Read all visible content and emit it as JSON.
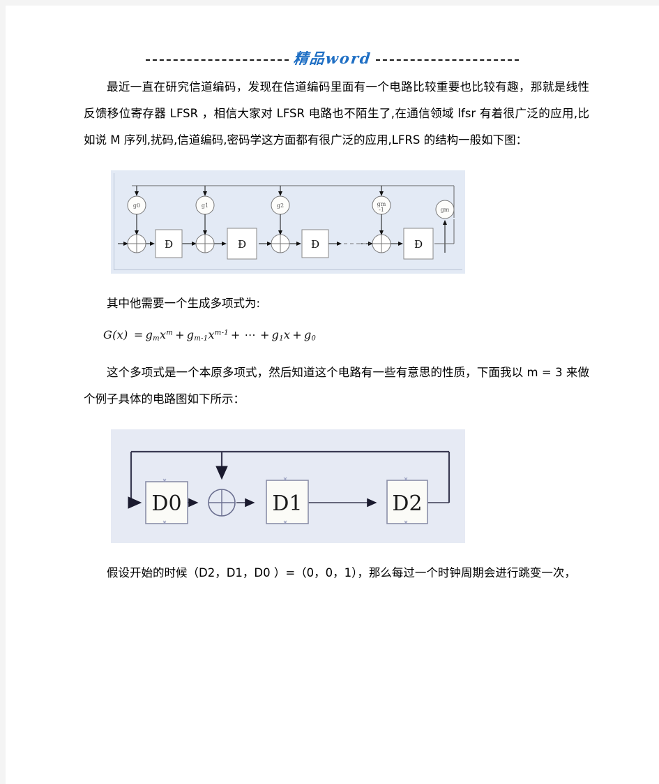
{
  "document": {
    "header": {
      "watermark": "精品word",
      "rule_style": "dashed"
    },
    "paragraphs": {
      "p1": "最近一直在研究信道编码，发现在信道编码里面有一个电路比较重要也比较有趣，那就是线性反馈移位寄存器 LFSR  ，相信大家对 LFSR  电路也不陌生了,在通信领域 lfsr 有着很广泛的应用,比如说 M 序列,扰码,信道编码,密码学这方面都有很广泛的应用,LFRS 的结构一般如下图：",
      "p2": "其中他需要一个生成多项式为:",
      "p3": "这个多项式是一个本原多项式，然后知道这个电路有一些有意思的性质，下面我以 m  = 3 来做个例子具体的电路图如下所示：",
      "p4": "假设开始的时候（D2，D1，D0  ）=（0，0，1），那么每过一个时钟周期会进行跳变一次，"
    },
    "formula": {
      "lhs": "G(x)",
      "equals": "=",
      "terms": [
        {
          "coef": "g",
          "coef_sub": "m",
          "var": "x",
          "var_sup": "m"
        },
        {
          "coef": "g",
          "coef_sub": "m-1",
          "var": "x",
          "var_sup": "m-1"
        },
        {
          "coef": "",
          "coef_sub": "",
          "var": "⋯",
          "var_sup": ""
        },
        {
          "coef": "g",
          "coef_sub": "1",
          "var": "x",
          "var_sup": ""
        },
        {
          "coef": "g",
          "coef_sub": "0",
          "var": "",
          "var_sup": ""
        }
      ],
      "plain": "G(x) = g_m x^m + g_{m-1} x^{m-1} + ⋯ + g_1 x + g_0"
    },
    "figure1": {
      "caption": "",
      "background_color": "#e3eaf5",
      "tap_labels": [
        "g0",
        "g1",
        "g2",
        "gm-1",
        "gm"
      ],
      "register_labels": [
        "D",
        "D",
        "D",
        "D"
      ],
      "xor_count": 4,
      "ellipsis": "- - -"
    },
    "figure2": {
      "caption": "",
      "background_color": "#e6eaf4",
      "register_labels": [
        "D0",
        "D1",
        "D2"
      ],
      "xor_count": 1
    }
  }
}
